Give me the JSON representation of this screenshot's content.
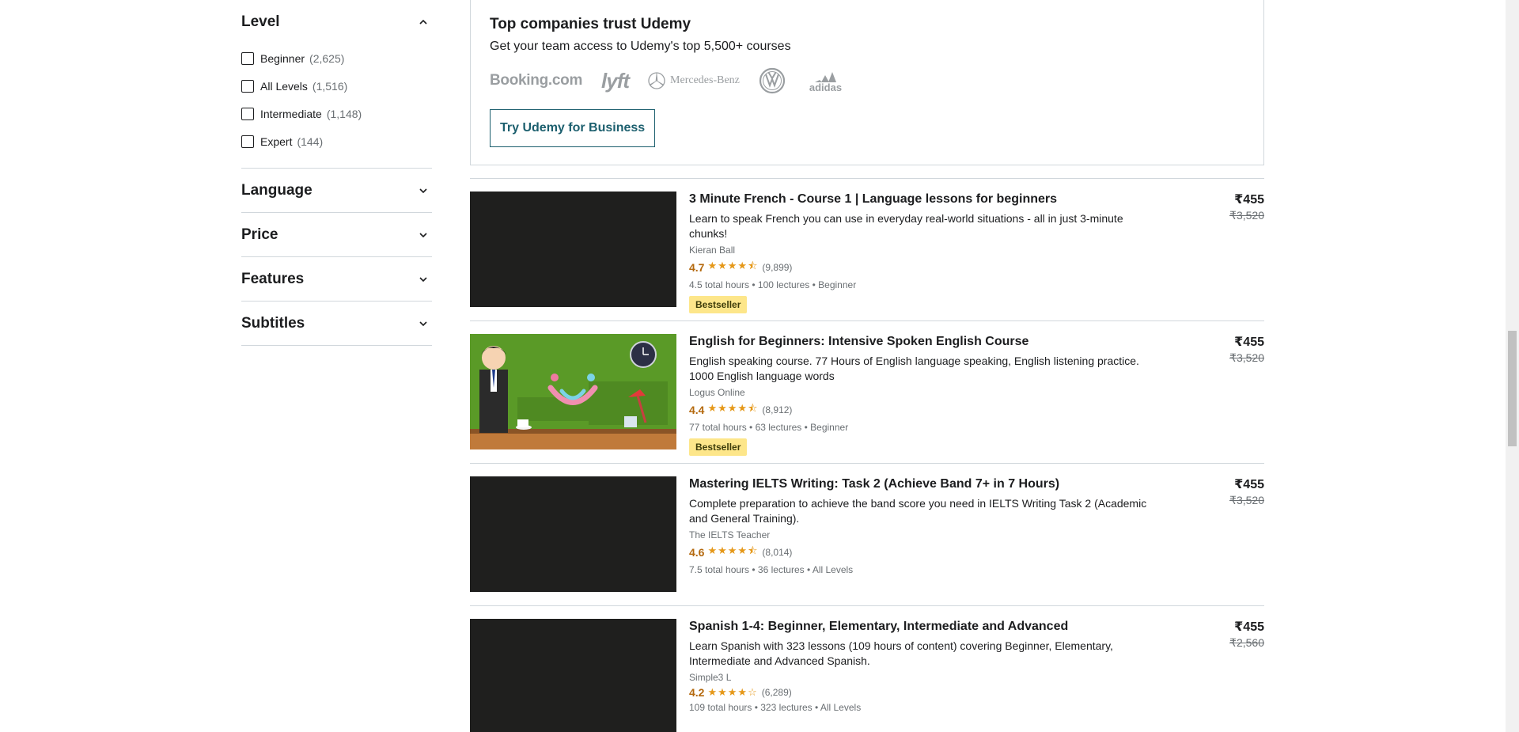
{
  "filters": {
    "level": {
      "title": "Level",
      "options": [
        {
          "label": "Beginner",
          "count": "(2,625)"
        },
        {
          "label": "All Levels",
          "count": "(1,516)"
        },
        {
          "label": "Intermediate",
          "count": "(1,148)"
        },
        {
          "label": "Expert",
          "count": "(144)"
        }
      ]
    },
    "language": {
      "title": "Language"
    },
    "price": {
      "title": "Price"
    },
    "features": {
      "title": "Features"
    },
    "subtitles": {
      "title": "Subtitles"
    }
  },
  "business": {
    "title": "Top companies trust Udemy",
    "subtitle": "Get your team access to Udemy's top 5,500+ courses",
    "logos": {
      "booking": "Booking.com",
      "lyft": "lyft",
      "mercedes": "Mercedes-Benz",
      "adidas": "adidas"
    },
    "button": "Try Udemy for Business"
  },
  "courses": [
    {
      "title": "3 Minute French - Course 1 | Language lessons for beginners",
      "description": "Learn to speak French you can use in everyday real-world situations - all in just 3-minute chunks!",
      "instructor": "Kieran Ball",
      "rating": "4.7",
      "stars": "★★★★⯪",
      "reviews": "(9,899)",
      "meta": "4.5 total hours • 100 lectures • Beginner",
      "badge": "Bestseller",
      "price": "₹455",
      "original_price": "₹3,520"
    },
    {
      "title": "English for Beginners: Intensive Spoken English Course",
      "description": "English speaking course. 77 Hours of English language speaking, English listening practice. 1000 English language words",
      "instructor": "Logus Online",
      "rating": "4.4",
      "stars": "★★★★⯪",
      "reviews": "(8,912)",
      "meta": "77 total hours • 63 lectures • Beginner",
      "badge": "Bestseller",
      "price": "₹455",
      "original_price": "₹3,520"
    },
    {
      "title": "Mastering IELTS Writing: Task 2 (Achieve Band 7+ in 7 Hours)",
      "description": "Complete preparation to achieve the band score you need in IELTS Writing Task 2 (Academic and General Training).",
      "instructor": "The IELTS Teacher",
      "rating": "4.6",
      "stars": "★★★★⯪",
      "reviews": "(8,014)",
      "meta": "7.5 total hours • 36 lectures • All Levels",
      "price": "₹455",
      "original_price": "₹3,520"
    },
    {
      "title": "Spanish 1-4: Beginner, Elementary, Intermediate and Advanced",
      "description": "Learn Spanish with 323 lessons (109 hours of content) covering Beginner, Elementary, Intermediate and Advanced Spanish.",
      "instructor": "Simple3 L",
      "rating": "4.2",
      "stars": "★★★★☆",
      "reviews": "(6,289)",
      "meta": "109 total hours • 323 lectures • All Levels",
      "price": "₹455",
      "original_price": "₹2,560"
    }
  ]
}
